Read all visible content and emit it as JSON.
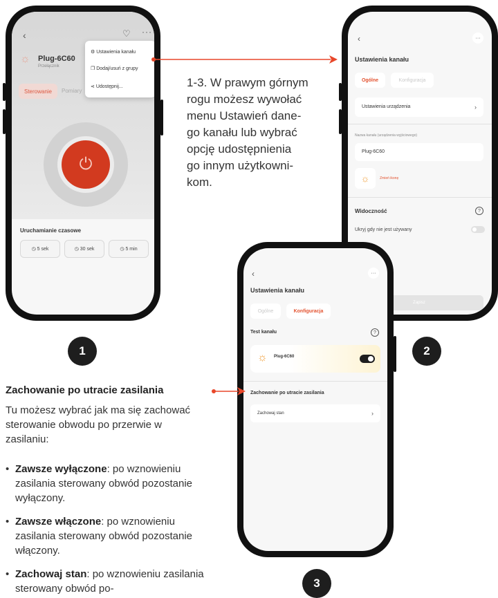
{
  "phone1": {
    "device_name": "Plug-6C60",
    "device_subtitle": "Przełącznik",
    "tab_active": "Sterowanie",
    "tab_inactive": "Pomiary",
    "menu": [
      "Ustawienia kanału",
      "Dodaj/usuń z grupy",
      "Udostępnij..."
    ],
    "timer_title": "Uruchamianie czasowe",
    "timers": [
      "5 sek",
      "30 sek",
      "5 min"
    ],
    "badge": "1"
  },
  "description": {
    "lines": [
      "1-3. W prawym górnym",
      "rogu możesz wywołać",
      "menu Ustawień dane-",
      "go kanału lub wybrać",
      "opcję udostępnienia",
      "go innym użytkowni-",
      "kom."
    ]
  },
  "phone2": {
    "title": "Ustawienia kanału",
    "tab_general": "Ogólne",
    "tab_config": "Konfiguracja",
    "device_settings": "Ustawienia urządzenia",
    "channel_name_label": "Nazwa kanału (urządzenia wyjściowego)",
    "channel_name_value": "Plug-6C60",
    "change_icon": "Zmień ikonę",
    "visibility": "Widoczność",
    "hide_unused": "Ukryj gdy nie jest używany",
    "save": "Zapisz",
    "badge": "2"
  },
  "phone3": {
    "title": "Ustawienia kanału",
    "tab_general": "Ogólne",
    "tab_config": "Konfiguracja",
    "test_channel": "Test kanału",
    "device_name": "Plug-6C60",
    "power_loss_title": "Zachowanie po utracie zasilania",
    "power_loss_value": "Zachowaj stan",
    "badge": "3"
  },
  "section": {
    "heading": "Zachowanie po utracie zasilania",
    "intro": "Tu możesz wybrać jak ma się zachować sterowanie obwodu po przerwie w zasilaniu:",
    "bullets": [
      {
        "bold": "Zawsze wyłączone",
        "text": ": po wznowieniu zasilania sterowany obwód pozostanie wyłączony."
      },
      {
        "bold": "Zawsze włączone",
        "text": ": po wznowieniu zasilania sterowany obwód pozostanie włączony."
      },
      {
        "bold": "Zachowaj stan",
        "text": ": po wznowieniu zasilania sterowany obwód po-"
      }
    ]
  },
  "colors": {
    "accent": "#e3522f",
    "arrow": "#e8472a",
    "power": "#d23a1f"
  }
}
